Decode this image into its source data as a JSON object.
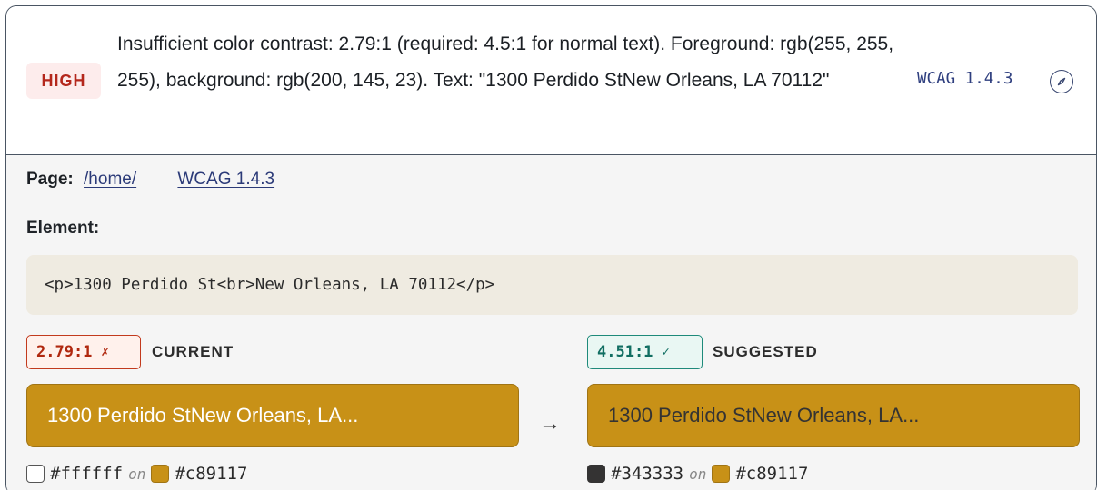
{
  "issue": {
    "severity": "HIGH",
    "message": "Insufficient color contrast: 2.79:1 (required: 4.5:1 for normal text). Foreground: rgb(255, 255, 255), background: rgb(200, 145, 23). Text: \"1300 Perdido StNew Orleans, LA 70112\"",
    "wcag_tag": "WCAG 1.4.3",
    "icon": "compass-icon"
  },
  "details": {
    "page_label": "Page:",
    "page_link": "/home/",
    "wcag_link": "WCAG 1.4.3",
    "element_label": "Element:",
    "element_code": "<p>1300 Perdido St<br>New Orleans, LA 70112</p>"
  },
  "current": {
    "ratio": "2.79:1",
    "mark": "✗",
    "label": "CURRENT",
    "preview_text": "1300 Perdido StNew Orleans, LA...",
    "fg": "#ffffff",
    "on": "on",
    "bg": "#c89117"
  },
  "suggested": {
    "ratio": "4.51:1",
    "mark": "✓",
    "label": "SUGGESTED",
    "preview_text": "1300 Perdido StNew Orleans, LA...",
    "fg": "#343333",
    "on": "on",
    "bg": "#c89117"
  },
  "arrow": "→",
  "colors": {
    "severity_high": "#b4271c",
    "preview_bg": "#c89117",
    "bad": "#c23a1d",
    "good": "#1e8a7a"
  }
}
